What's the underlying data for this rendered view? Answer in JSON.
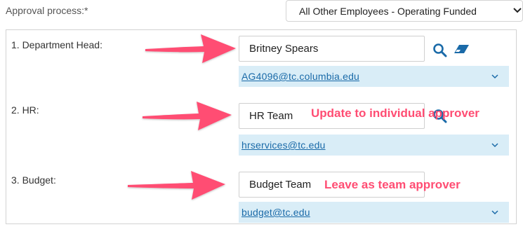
{
  "approval_process": {
    "label": "Approval process:*",
    "selected": "All Other Employees - Operating Funded"
  },
  "steps": [
    {
      "label": "1.  Department Head:",
      "name": "Britney Spears",
      "email": "AG4096@tc.columbia.edu"
    },
    {
      "label": "2.  HR:",
      "name": "HR Team",
      "email": "hrservices@tc.edu"
    },
    {
      "label": "3.  Budget:",
      "name": "Budget Team",
      "email": "budget@tc.edu"
    }
  ],
  "annotations": {
    "hr": "Update to individual approver",
    "budget": "Leave as team approver"
  },
  "colors": {
    "annotation": "#ff4d73",
    "email_link": "#1a6aa8",
    "email_row_bg": "#d9edf7",
    "search_icon": "#1a6aa8"
  },
  "icons": [
    "search-icon",
    "eraser-icon",
    "chevron-down-icon"
  ]
}
